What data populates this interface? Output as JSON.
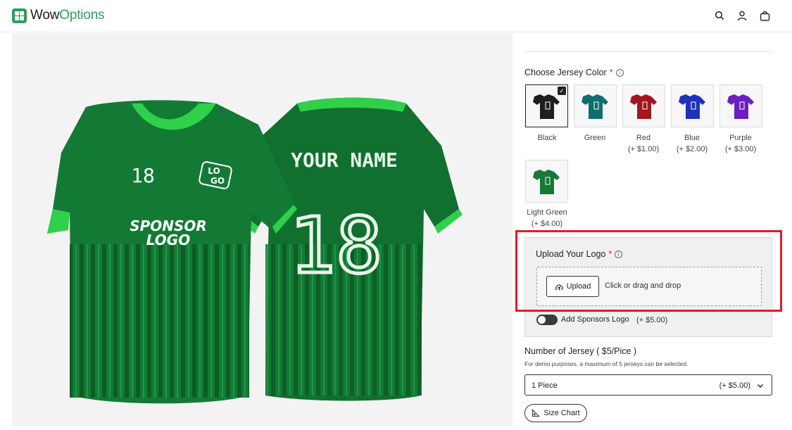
{
  "brand": {
    "name_part1": "Wow",
    "name_part2": "Options",
    "accent": "#2e9e57"
  },
  "header_icons": [
    "search-icon",
    "user-icon",
    "bag-icon"
  ],
  "product_image": {
    "front_text_number": "18",
    "front_text_logo_line1": "LO",
    "front_text_logo_line2": "GO",
    "front_text_sponsor_line1": "SPONSOR",
    "front_text_sponsor_line2": "LOGO",
    "back_text_name": "YOUR NAME",
    "back_text_number": "18",
    "jersey_color": "#137a35",
    "trim_color": "#2fd04a"
  },
  "jersey_color": {
    "label": "Choose Jersey Color",
    "required_mark": "*",
    "info": "i",
    "options": [
      {
        "name": "Black",
        "price": "",
        "color": "#1e1e1e",
        "selected": true
      },
      {
        "name": "Green",
        "price": "",
        "color": "#0f6e6e",
        "selected": false
      },
      {
        "name": "Red",
        "price": "(+ $1.00)",
        "color": "#a3161d",
        "selected": false
      },
      {
        "name": "Blue",
        "price": "(+ $2.00)",
        "color": "#1f33b8",
        "selected": false
      },
      {
        "name": "Purple",
        "price": "(+ $3.00)",
        "color": "#6b1fbf",
        "selected": false
      },
      {
        "name": "Light Green",
        "price": "(+ $4.00)",
        "color": "#157a35",
        "selected": false
      }
    ]
  },
  "upload_logo": {
    "label": "Upload Your Logo",
    "required_mark": "*",
    "info": "i",
    "button_label": "Upload",
    "hint": "Click or drag and drop",
    "sponsor_toggle_label": "Add Sponsors Logo",
    "sponsor_toggle_price": "(+ $5.00)",
    "sponsor_toggle_on": false
  },
  "quantity": {
    "title": "Number of Jersey ( $5/Pice )",
    "note": "For demo purposes, a maximum of 5 jerseys can be selected.",
    "selected_value": "1 Piece",
    "selected_price": "(+ $5.00)"
  },
  "size_chart": {
    "label": "Size Chart"
  }
}
